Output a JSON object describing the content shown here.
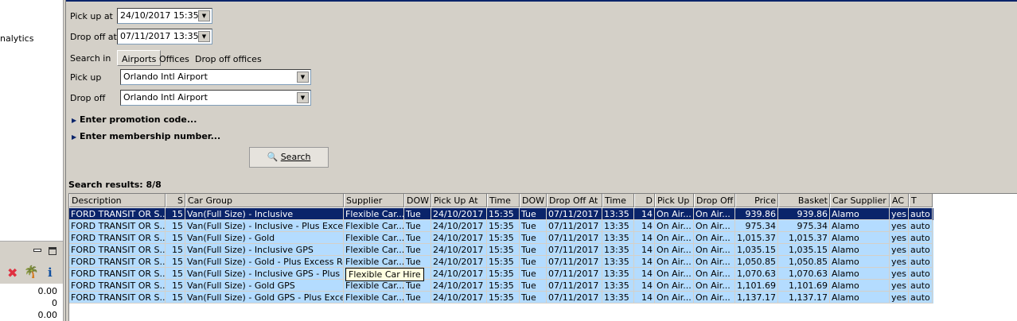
{
  "left": {
    "nav_item": "nalytics",
    "values": [
      "0.00",
      "0",
      "0.00"
    ]
  },
  "form": {
    "pickup_at_label": "Pick up at",
    "pickup_at": "24/10/2017 15:35",
    "dropoff_at_label": "Drop off at",
    "dropoff_at": "07/11/2017 13:35",
    "search_in_label": "Search in",
    "search_in_tabs": [
      "Airports",
      "Offices",
      "Drop off offices"
    ],
    "pickup_label": "Pick up",
    "pickup": "Orlando Intl Airport",
    "dropoff_label": "Drop off",
    "dropoff": "Orlando Intl Airport",
    "promo": "Enter promotion code...",
    "membership": "Enter membership number...",
    "search_button": "Search"
  },
  "results": {
    "title": "Search results: 8/8",
    "columns": [
      "Description",
      "S",
      "Car Group",
      "Supplier",
      "DOW",
      "Pick Up At",
      "Time",
      "DOW",
      "Drop Off At",
      "Time",
      "D",
      "Pick Up",
      "Drop Off",
      "Price",
      "Basket",
      "Car Supplier",
      "AC",
      "T"
    ],
    "rows": [
      [
        "FORD TRANSIT OR S...",
        "15",
        "Van(Full Size) - Inclusive",
        "Flexible Car...",
        "Tue",
        "24/10/2017",
        "15:35",
        "Tue",
        "07/11/2017",
        "13:35",
        "14",
        "On Air...",
        "On Air...",
        "939.86",
        "939.86",
        "Alamo",
        "yes",
        "auto"
      ],
      [
        "FORD TRANSIT OR S...",
        "15",
        "Van(Full Size) - Inclusive - Plus Excess...",
        "Flexible Car...",
        "Tue",
        "24/10/2017",
        "15:35",
        "Tue",
        "07/11/2017",
        "13:35",
        "14",
        "On Air...",
        "On Air...",
        "975.34",
        "975.34",
        "Alamo",
        "yes",
        "auto"
      ],
      [
        "FORD TRANSIT OR S...",
        "15",
        "Van(Full Size) - Gold",
        "Flexible Car...",
        "Tue",
        "24/10/2017",
        "15:35",
        "Tue",
        "07/11/2017",
        "13:35",
        "14",
        "On Air...",
        "On Air...",
        "1,015.37",
        "1,015.37",
        "Alamo",
        "yes",
        "auto"
      ],
      [
        "FORD TRANSIT OR S...",
        "15",
        "Van(Full Size) - Inclusive GPS",
        "Flexible Car...",
        "Tue",
        "24/10/2017",
        "15:35",
        "Tue",
        "07/11/2017",
        "13:35",
        "14",
        "On Air...",
        "On Air...",
        "1,035.15",
        "1,035.15",
        "Alamo",
        "yes",
        "auto"
      ],
      [
        "FORD TRANSIT OR S...",
        "15",
        "Van(Full Size) - Gold - Plus Excess Ref...",
        "Flexible Car...",
        "Tue",
        "24/10/2017",
        "15:35",
        "Tue",
        "07/11/2017",
        "13:35",
        "14",
        "On Air...",
        "On Air...",
        "1,050.85",
        "1,050.85",
        "Alamo",
        "yes",
        "auto"
      ],
      [
        "FORD TRANSIT OR S...",
        "15",
        "Van(Full Size) - Inclusive GPS - Plus Ex...",
        "Flexible Car...",
        "Tue",
        "24/10/2017",
        "15:35",
        "Tue",
        "07/11/2017",
        "13:35",
        "14",
        "On Air...",
        "On Air...",
        "1,070.63",
        "1,070.63",
        "Alamo",
        "yes",
        "auto"
      ],
      [
        "FORD TRANSIT OR S...",
        "15",
        "Van(Full Size) - Gold GPS",
        "Flexible Car...",
        "Tue",
        "24/10/2017",
        "15:35",
        "Tue",
        "07/11/2017",
        "13:35",
        "14",
        "On Air...",
        "On Air...",
        "1,101.69",
        "1,101.69",
        "Alamo",
        "yes",
        "auto"
      ],
      [
        "FORD TRANSIT OR S...",
        "15",
        "Van(Full Size) - Gold GPS - Plus Excess...",
        "Flexible Car...",
        "Tue",
        "24/10/2017",
        "15:35",
        "Tue",
        "07/11/2017",
        "13:35",
        "14",
        "On Air...",
        "On Air...",
        "1,137.17",
        "1,137.17",
        "Alamo",
        "yes",
        "auto"
      ]
    ],
    "tooltip": "Flexible Car Hire"
  }
}
